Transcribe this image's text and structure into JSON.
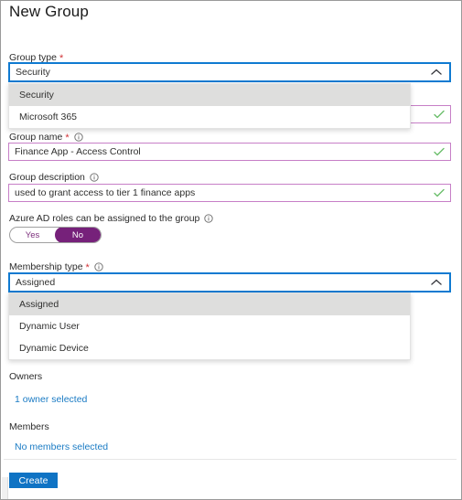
{
  "panel": {
    "title": "New Group"
  },
  "group_type": {
    "label": "Group type",
    "required_marker": "*",
    "value": "Security",
    "chevron": "chevron-up-icon",
    "options": [
      {
        "label": "Security",
        "selected": true
      },
      {
        "label": "Microsoft 365",
        "selected": false
      }
    ]
  },
  "hidden_field_behind_dropdown": {
    "value": "",
    "validation_icon": "green-check-icon"
  },
  "group_name": {
    "label": "Group name",
    "required_marker": "*",
    "info_icon": "info-circle-icon",
    "value": "Finance App - Access Control",
    "placeholder": "",
    "validation_icon": "green-check-icon"
  },
  "group_description": {
    "label": "Group description",
    "info_icon": "info-circle-icon",
    "value": "used to grant access to tier 1 finance apps",
    "placeholder": "",
    "validation_icon": "green-check-icon"
  },
  "azure_ad_roles": {
    "label": "Azure AD roles can be assigned to the group",
    "info_icon": "info-circle-icon",
    "options": [
      {
        "label": "Yes",
        "selected": false
      },
      {
        "label": "No",
        "selected": true
      }
    ]
  },
  "membership_type": {
    "label": "Membership type",
    "required_marker": "*",
    "info_icon": "info-circle-icon",
    "value": "Assigned",
    "chevron": "chevron-up-icon",
    "options": [
      {
        "label": "Assigned",
        "selected": true
      },
      {
        "label": "Dynamic User",
        "selected": false
      },
      {
        "label": "Dynamic Device",
        "selected": false
      }
    ]
  },
  "owners": {
    "heading": "Owners",
    "link_text": "1 owner selected"
  },
  "members": {
    "heading": "Members",
    "link_text": "No members selected"
  },
  "footer": {
    "create_label": "Create"
  },
  "colors": {
    "accent_blue": "#0f73c4",
    "focus_blue": "#0f7ad1",
    "link_blue": "#1a7bc4",
    "toggle_purple": "#76217a",
    "input_purple": "#c77fc7",
    "valid_green": "#6bbe6b",
    "required_red": "#d13438",
    "option_highlight": "#dededd"
  }
}
